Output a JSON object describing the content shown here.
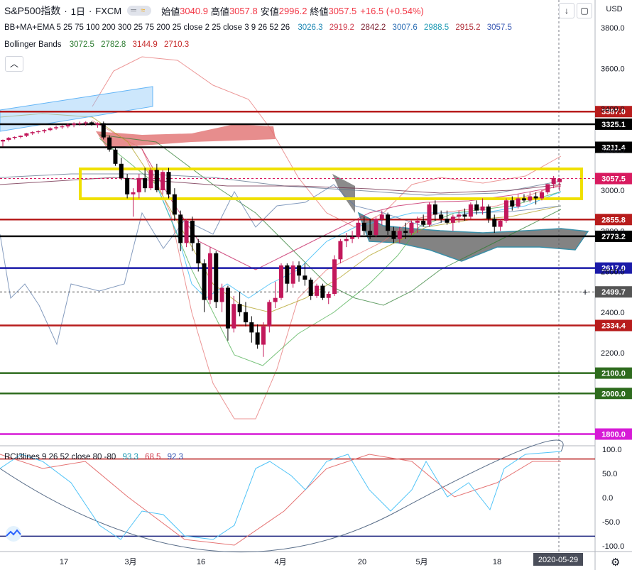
{
  "header": {
    "symbol": "S&P500指数",
    "interval": "1日",
    "exchange": "FXCM",
    "open_label": "始値",
    "open": "3040.9",
    "high_label": "高値",
    "high": "3057.8",
    "low_label": "安値",
    "low": "2996.2",
    "close_label": "終値",
    "close": "3057.5",
    "change": "+16.5 (+0.54%)"
  },
  "indicators": {
    "ma": {
      "label": "BB+MA+EMA 5 25 75 100 200 300 25 75 200 25 close 2 25 close 3 9 26 52 26",
      "values": [
        "3026.3",
        "2919.2",
        "2842.2",
        "3007.6",
        "2988.5",
        "2915.2",
        "3057.5"
      ]
    },
    "bb": {
      "label": "Bollinger Bands",
      "values": [
        "3072.5",
        "2782.8",
        "3144.9",
        "2710.3"
      ]
    },
    "rci": {
      "label": "RCI3lines 9 26 52 close 80 -80",
      "values": [
        "93.3",
        "68.5",
        "92.3"
      ]
    }
  },
  "currency": "USD",
  "price_axis": {
    "ticks": [
      "3800.0",
      "3600.0",
      "3400.0",
      "3200.0",
      "3000.0",
      "2800.0",
      "2600.0",
      "2400.0",
      "2200.0"
    ],
    "levels": [
      {
        "value": "3387.0",
        "color": "#b71c1c"
      },
      {
        "value": "3325.1",
        "color": "#000000"
      },
      {
        "value": "3211.4",
        "color": "#000000"
      },
      {
        "value": "3057.5",
        "color": "#d81b60"
      },
      {
        "value": "2855.8",
        "color": "#b71c1c"
      },
      {
        "value": "2773.2",
        "color": "#000000"
      },
      {
        "value": "2617.0",
        "color": "#1a1aa8"
      },
      {
        "value": "2499.7",
        "color": "#555555"
      },
      {
        "value": "2334.4",
        "color": "#b71c1c"
      },
      {
        "value": "2100.0",
        "color": "#2e6b1e"
      },
      {
        "value": "2000.0",
        "color": "#2e6b1e"
      },
      {
        "value": "1800.0",
        "color": "#d61ad6"
      }
    ]
  },
  "rci_axis": {
    "ticks": [
      "100.0",
      "50.0",
      "0.0",
      "-50.0",
      "-100.0"
    ]
  },
  "time_axis": {
    "labels": [
      "17",
      "3月",
      "16",
      "4月",
      "20",
      "5月",
      "18"
    ],
    "current_date": "2020-05-29"
  },
  "colors": {
    "up": "#c2185b",
    "down": "#000000",
    "highlight": "#f0e000"
  },
  "chart_data": {
    "type": "candlestick",
    "series": [
      {
        "name": "S&P500指数",
        "ohlc_note": "daily candles estimated from axis",
        "values": [
          [
            3240,
            3250,
            3215,
            3248
          ],
          [
            3248,
            3262,
            3240,
            3258
          ],
          [
            3258,
            3265,
            3250,
            3262
          ],
          [
            3262,
            3270,
            3255,
            3268
          ],
          [
            3268,
            3282,
            3262,
            3280
          ],
          [
            3280,
            3290,
            3272,
            3286
          ],
          [
            3286,
            3295,
            3278,
            3290
          ],
          [
            3290,
            3300,
            3282,
            3296
          ],
          [
            3296,
            3310,
            3290,
            3305
          ],
          [
            3305,
            3318,
            3298,
            3310
          ],
          [
            3310,
            3322,
            3302,
            3314
          ],
          [
            3314,
            3330,
            3306,
            3322
          ],
          [
            3322,
            3334,
            3310,
            3328
          ],
          [
            3328,
            3338,
            3318,
            3330
          ],
          [
            3330,
            3340,
            3318,
            3334
          ],
          [
            3334,
            3340,
            3318,
            3322
          ],
          [
            3322,
            3334,
            3308,
            3330
          ],
          [
            3330,
            3338,
            3250,
            3260
          ],
          [
            3260,
            3270,
            3190,
            3200
          ],
          [
            3200,
            3210,
            3120,
            3130
          ],
          [
            3130,
            3160,
            3050,
            3060
          ],
          [
            3060,
            3080,
            2960,
            2980
          ],
          [
            2980,
            3010,
            2870,
            2990
          ],
          [
            2990,
            3080,
            2960,
            3060
          ],
          [
            3060,
            3110,
            2990,
            3010
          ],
          [
            3010,
            3110,
            3000,
            3100
          ],
          [
            3100,
            3130,
            2990,
            3000
          ],
          [
            3000,
            3100,
            2980,
            3090
          ],
          [
            3090,
            3110,
            2960,
            2980
          ],
          [
            2980,
            3010,
            2850,
            2880
          ],
          [
            2880,
            2900,
            2700,
            2740
          ],
          [
            2740,
            2860,
            2720,
            2850
          ],
          [
            2850,
            2870,
            2700,
            2740
          ],
          [
            2740,
            2760,
            2600,
            2640
          ],
          [
            2640,
            2660,
            2400,
            2460
          ],
          [
            2460,
            2720,
            2440,
            2690
          ],
          [
            2690,
            2700,
            2420,
            2450
          ],
          [
            2450,
            2540,
            2400,
            2520
          ],
          [
            2520,
            2530,
            2260,
            2320
          ],
          [
            2320,
            2480,
            2300,
            2440
          ],
          [
            2440,
            2500,
            2380,
            2400
          ],
          [
            2400,
            2450,
            2330,
            2350
          ],
          [
            2350,
            2380,
            2250,
            2300
          ],
          [
            2300,
            2340,
            2220,
            2240
          ],
          [
            2240,
            2350,
            2180,
            2330
          ],
          [
            2330,
            2460,
            2300,
            2450
          ],
          [
            2450,
            2550,
            2420,
            2470
          ],
          [
            2470,
            2640,
            2460,
            2630
          ],
          [
            2630,
            2640,
            2500,
            2540
          ],
          [
            2540,
            2650,
            2520,
            2630
          ],
          [
            2630,
            2650,
            2550,
            2580
          ],
          [
            2580,
            2640,
            2530,
            2560
          ],
          [
            2560,
            2570,
            2460,
            2480
          ],
          [
            2480,
            2540,
            2470,
            2530
          ],
          [
            2530,
            2540,
            2460,
            2470
          ],
          [
            2470,
            2500,
            2440,
            2490
          ],
          [
            2490,
            2680,
            2480,
            2660
          ],
          [
            2660,
            2760,
            2640,
            2750
          ],
          [
            2750,
            2790,
            2720,
            2760
          ],
          [
            2760,
            2800,
            2740,
            2770
          ],
          [
            2770,
            2860,
            2760,
            2840
          ],
          [
            2840,
            2870,
            2780,
            2800
          ],
          [
            2800,
            2860,
            2760,
            2780
          ],
          [
            2780,
            2870,
            2770,
            2860
          ],
          [
            2860,
            2900,
            2830,
            2880
          ],
          [
            2880,
            2890,
            2780,
            2800
          ],
          [
            2800,
            2820,
            2740,
            2760
          ],
          [
            2760,
            2820,
            2740,
            2800
          ],
          [
            2800,
            2840,
            2760,
            2790
          ],
          [
            2790,
            2850,
            2780,
            2840
          ],
          [
            2840,
            2870,
            2790,
            2850
          ],
          [
            2850,
            2880,
            2820,
            2830
          ],
          [
            2830,
            2940,
            2820,
            2930
          ],
          [
            2930,
            2950,
            2850,
            2880
          ],
          [
            2880,
            2900,
            2840,
            2860
          ],
          [
            2860,
            2900,
            2830,
            2840
          ],
          [
            2840,
            2880,
            2800,
            2870
          ],
          [
            2870,
            2900,
            2840,
            2880
          ],
          [
            2880,
            2910,
            2850,
            2870
          ],
          [
            2870,
            2940,
            2860,
            2930
          ],
          [
            2930,
            2950,
            2880,
            2900
          ],
          [
            2900,
            2960,
            2880,
            2920
          ],
          [
            2920,
            2930,
            2840,
            2860
          ],
          [
            2860,
            2880,
            2790,
            2820
          ],
          [
            2820,
            2860,
            2800,
            2850
          ],
          [
            2850,
            2960,
            2840,
            2950
          ],
          [
            2950,
            2970,
            2900,
            2920
          ],
          [
            2920,
            2980,
            2910,
            2960
          ],
          [
            2960,
            2980,
            2940,
            2950
          ],
          [
            2950,
            2990,
            2940,
            2970
          ],
          [
            2970,
            2990,
            2930,
            2960
          ],
          [
            2960,
            3000,
            2950,
            2990
          ],
          [
            2990,
            3030,
            2980,
            3030
          ],
          [
            3030,
            3070,
            3010,
            3060
          ],
          [
            3040,
            3058,
            2996,
            3057
          ]
        ]
      }
    ],
    "xlabel": "",
    "ylabel": "",
    "ylim": [
      1745,
      3850
    ]
  }
}
